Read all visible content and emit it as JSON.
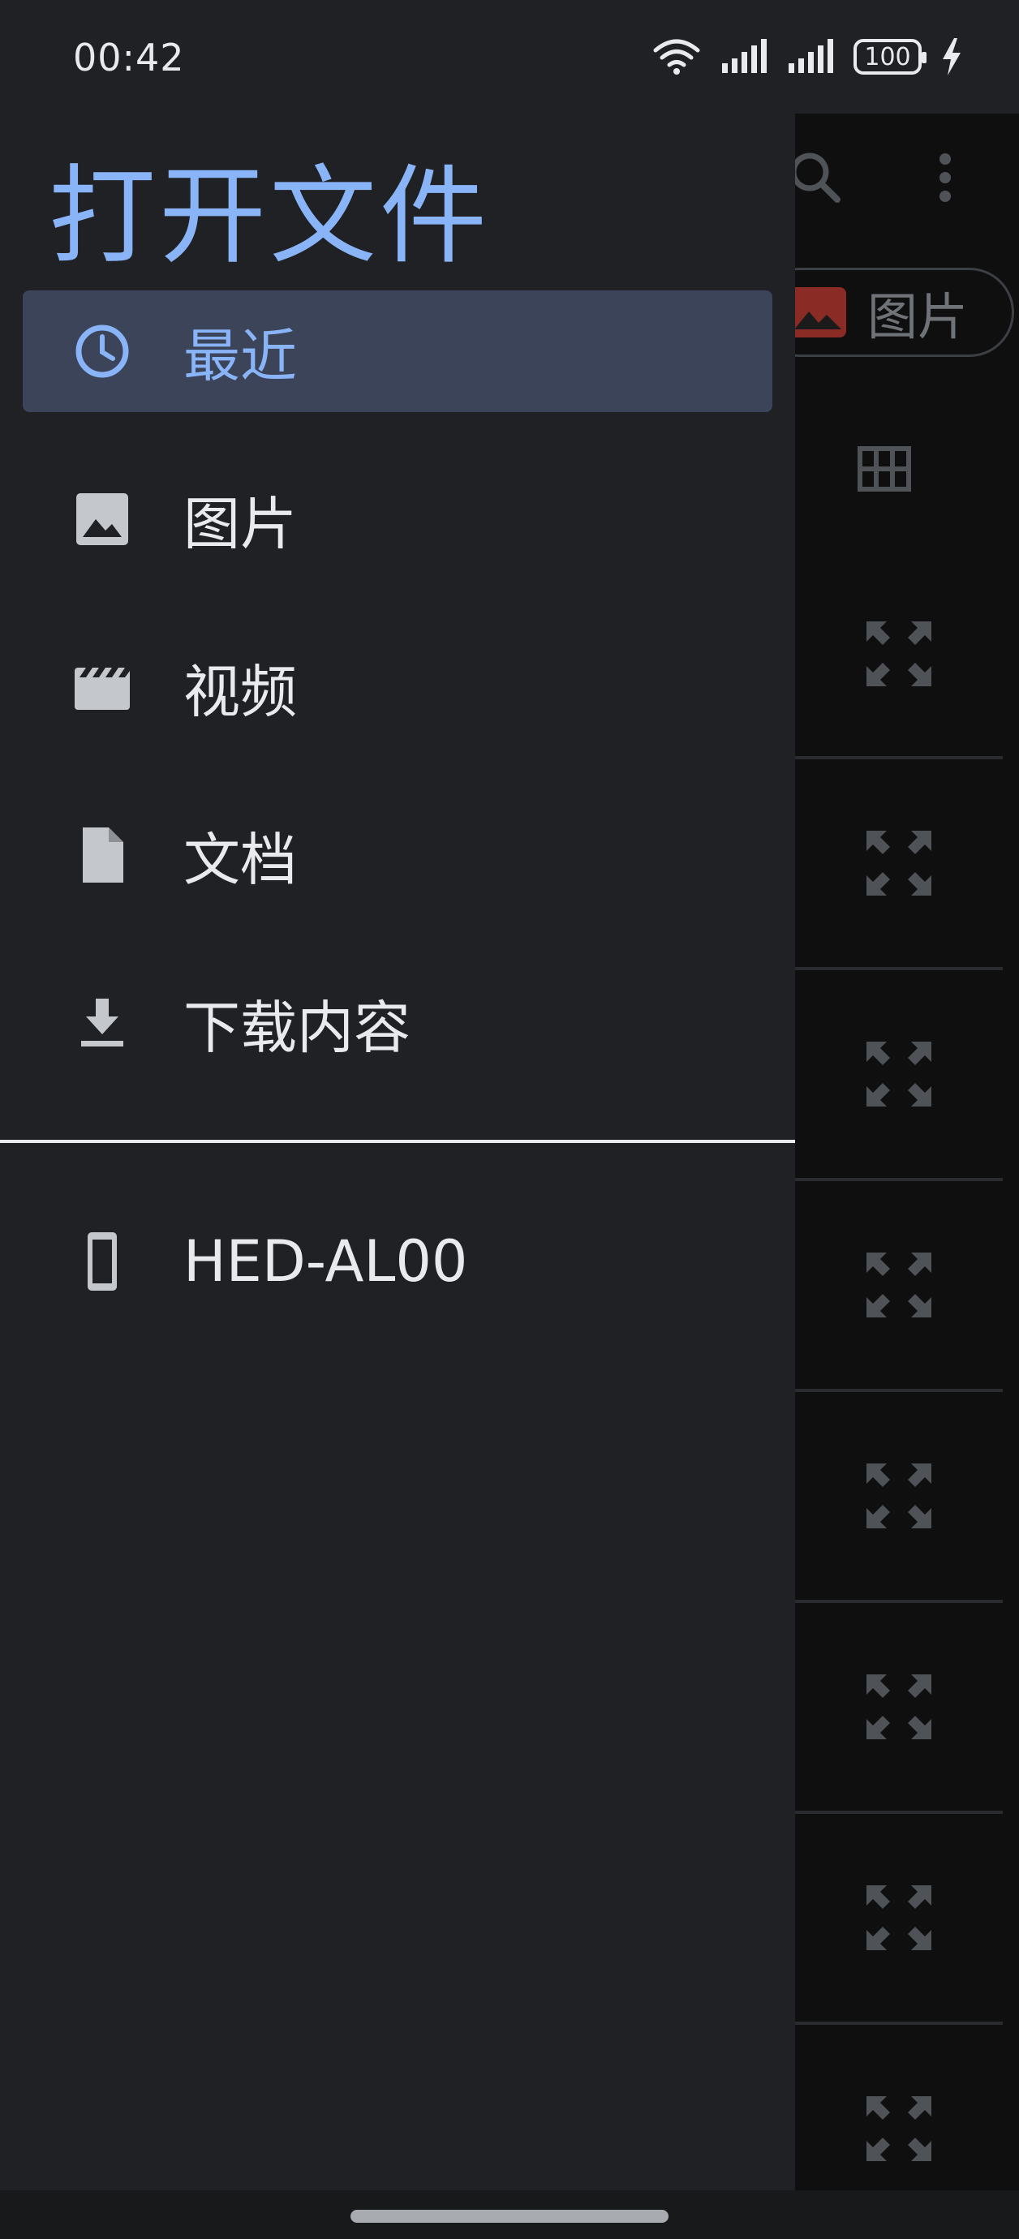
{
  "status_bar": {
    "time": "00:42",
    "battery": "100",
    "icons": [
      "wifi-icon",
      "signal-icon",
      "signal-icon",
      "battery-icon",
      "charging-icon"
    ]
  },
  "drawer": {
    "title": "打开文件",
    "items": [
      {
        "label": "最近",
        "icon": "clock-icon",
        "active": true
      },
      {
        "label": "图片",
        "icon": "image-icon",
        "active": false
      },
      {
        "label": "视频",
        "icon": "video-icon",
        "active": false
      },
      {
        "label": "文档",
        "icon": "document-icon",
        "active": false
      },
      {
        "label": "下载内容",
        "icon": "download-icon",
        "active": false
      }
    ],
    "device": {
      "label": "HED-AL00",
      "icon": "phone-icon"
    }
  },
  "background": {
    "chip_label": "图片",
    "colors": {
      "accent": "#8ab4f8",
      "drawer_bg": "#202124",
      "active_bg": "#3b4458"
    }
  }
}
